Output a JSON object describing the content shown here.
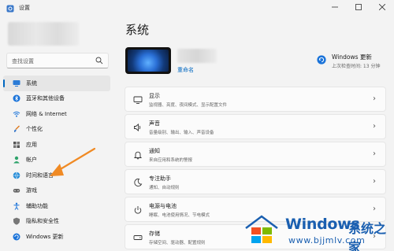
{
  "window": {
    "title": "设置"
  },
  "search": {
    "placeholder": "查找设置"
  },
  "sidebar": {
    "items": [
      {
        "label": "系统",
        "icon": "monitor-icon",
        "selected": true
      },
      {
        "label": "蓝牙和其他设备",
        "icon": "bluetooth-icon"
      },
      {
        "label": "网络 & Internet",
        "icon": "wifi-icon"
      },
      {
        "label": "个性化",
        "icon": "brush-icon"
      },
      {
        "label": "应用",
        "icon": "apps-icon"
      },
      {
        "label": "帐户",
        "icon": "person-icon"
      },
      {
        "label": "时间和语言",
        "icon": "globe-clock-icon"
      },
      {
        "label": "游戏",
        "icon": "gamepad-icon"
      },
      {
        "label": "辅助功能",
        "icon": "accessibility-icon"
      },
      {
        "label": "隐私和安全性",
        "icon": "shield-icon"
      },
      {
        "label": "Windows 更新",
        "icon": "update-icon"
      }
    ]
  },
  "main": {
    "title": "系统",
    "device": {
      "rename_label": "重命名"
    },
    "windows_update": {
      "title": "Windows 更新",
      "subtitle": "上次检查时间: 13 分钟"
    },
    "cards": [
      {
        "title": "显示",
        "subtitle": "监视器、亮度、夜间模式、显示配置文件",
        "icon": "display-icon"
      },
      {
        "title": "声音",
        "subtitle": "音量级别、输出、输入、声音设备",
        "icon": "speaker-icon"
      },
      {
        "title": "通知",
        "subtitle": "来自应用和系统的警报",
        "icon": "bell-icon"
      },
      {
        "title": "专注助手",
        "subtitle": "通知、自动规则",
        "icon": "moon-icon"
      },
      {
        "title": "电源与电池",
        "subtitle": "睡眠、电池使用情况、节电模式",
        "icon": "power-icon"
      },
      {
        "title": "存储",
        "subtitle": "存储空间、驱动器、配置规则",
        "icon": "storage-icon"
      }
    ]
  },
  "watermark": {
    "brand": "Windows",
    "brand_cn": "系统之家",
    "url": "www.bjjmlv.com"
  },
  "colors": {
    "accent": "#0067c0",
    "annotation_arrow": "#f08a24",
    "watermark": "#1a5fb0"
  }
}
